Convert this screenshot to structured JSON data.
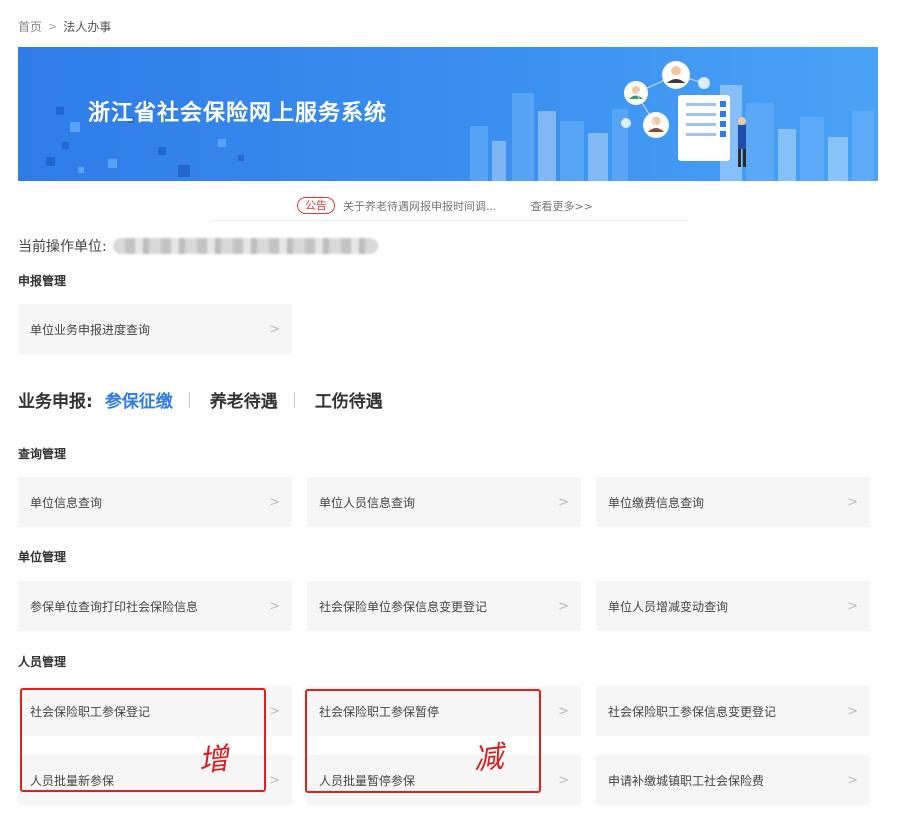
{
  "breadcrumb": {
    "home": "首页",
    "sep": ">",
    "current": "法人办事"
  },
  "banner": {
    "title": "浙江省社会保险网上服务系统"
  },
  "notice": {
    "badge": "公告",
    "text": "关于养老待遇网报申报时间调...",
    "more": "查看更多>>"
  },
  "unit": {
    "label": "当前操作单位:"
  },
  "sections": {
    "report": "申报管理",
    "query": "查询管理",
    "unit": "单位管理",
    "person": "人员管理"
  },
  "report_cards": [
    "单位业务申报进度查询"
  ],
  "business": {
    "label": "业务申报:",
    "tabs": [
      "参保征缴",
      "养老待遇",
      "工伤待遇"
    ]
  },
  "query_cards": [
    "单位信息查询",
    "单位人员信息查询",
    "单位缴费信息查询"
  ],
  "unit_cards": [
    "参保单位查询打印社会保险信息",
    "社会保险单位参保信息变更登记",
    "单位人员增减变动查询"
  ],
  "person_cards": [
    "社会保险职工参保登记",
    "社会保险职工参保暂停",
    "社会保险职工参保信息变更登记",
    "人员批量新参保",
    "人员批量暂停参保",
    "申请补缴城镇职工社会保险费"
  ],
  "arrow": ">",
  "annotations": {
    "add": "增",
    "reduce": "减"
  },
  "colors": {
    "accent": "#2f7ce8",
    "notice": "#e23b3b",
    "annotation": "#e02020"
  }
}
